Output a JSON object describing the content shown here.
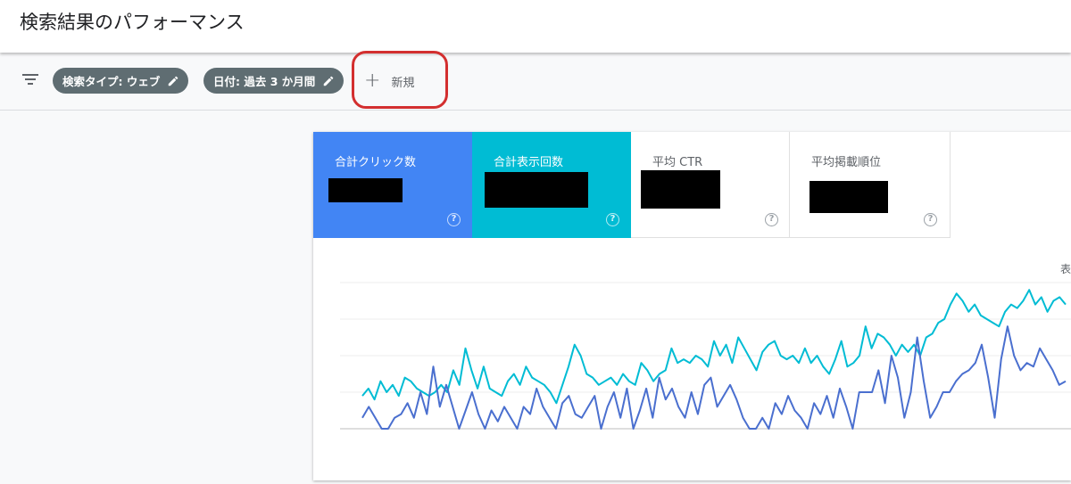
{
  "header": {
    "title": "検索結果のパフォーマンス"
  },
  "filters": {
    "chips": [
      {
        "label": "検索タイプ: ウェブ"
      },
      {
        "label": "日付: 過去 3 か月間"
      }
    ],
    "new_label": "新規"
  },
  "metrics": [
    {
      "label": "合計クリック数",
      "color": "#4285f4",
      "help": "?"
    },
    {
      "label": "合計表示回数",
      "color": "#00bcd4",
      "help": "?"
    },
    {
      "label": "平均 CTR",
      "help": "?"
    },
    {
      "label": "平均掲載順位",
      "help": "?"
    }
  ],
  "chart_legend_fragment": "表",
  "chart_data": {
    "type": "line",
    "title": "",
    "xlabel": "",
    "ylabel": "",
    "grid": true,
    "series": [
      {
        "color": "#00bcd4",
        "values": [
          0.9,
          1.1,
          0.8,
          1.3,
          1.0,
          1.2,
          0.9,
          1.4,
          1.3,
          1.1,
          1.0,
          0.9,
          1.0,
          1.2,
          1.0,
          1.6,
          1.2,
          2.2,
          1.6,
          1.1,
          1.7,
          1.1,
          1.0,
          0.9,
          1.3,
          1.5,
          1.2,
          1.7,
          1.4,
          1.3,
          1.2,
          1.0,
          0.7,
          1.2,
          1.7,
          2.3,
          2.0,
          1.5,
          1.4,
          1.2,
          1.3,
          1.4,
          1.2,
          1.5,
          1.3,
          1.2,
          1.8,
          1.6,
          1.3,
          1.5,
          1.6,
          2.2,
          1.8,
          1.9,
          1.8,
          2.0,
          1.9,
          1.7,
          2.4,
          2.0,
          2.3,
          1.8,
          2.5,
          2.2,
          1.9,
          1.6,
          2.1,
          2.3,
          2.4,
          2.0,
          1.9,
          2.0,
          1.8,
          2.2,
          1.8,
          2.0,
          1.7,
          1.5,
          1.9,
          2.4,
          1.7,
          1.8,
          2.0,
          2.8,
          2.2,
          2.6,
          2.5,
          2.3,
          2.0,
          2.3,
          2.1,
          2.3,
          2.0,
          2.5,
          2.6,
          2.9,
          3.0,
          3.4,
          3.7,
          3.5,
          3.2,
          3.4,
          3.1,
          3.0,
          2.9,
          2.8,
          3.2,
          3.4,
          3.3,
          3.5,
          3.8,
          3.4,
          3.6,
          3.2,
          3.5,
          3.6,
          3.4
        ]
      },
      {
        "color": "#4a6fcf",
        "values": [
          0.3,
          0.6,
          0.3,
          0.0,
          0.0,
          0.3,
          0.4,
          0.7,
          0.3,
          1.0,
          0.4,
          1.7,
          0.6,
          1.2,
          0.6,
          0.0,
          0.5,
          1.0,
          0.4,
          0.0,
          0.5,
          0.2,
          0.6,
          0.3,
          0.0,
          0.6,
          0.4,
          1.1,
          0.6,
          0.3,
          0.0,
          0.7,
          0.9,
          0.4,
          0.3,
          0.6,
          0.9,
          0.0,
          0.6,
          1.0,
          0.3,
          1.1,
          0.0,
          0.5,
          1.1,
          0.3,
          1.4,
          0.8,
          1.1,
          0.6,
          0.3,
          1.0,
          0.4,
          1.2,
          1.4,
          0.6,
          0.9,
          1.2,
          0.8,
          0.3,
          0.0,
          0.0,
          0.3,
          0.0,
          0.7,
          0.4,
          0.9,
          0.5,
          0.3,
          0.0,
          0.7,
          0.4,
          0.9,
          0.3,
          1.1,
          0.6,
          0.0,
          1.0,
          1.0,
          1.0,
          1.6,
          0.7,
          2.0,
          1.4,
          0.3,
          1.0,
          2.5,
          1.3,
          0.3,
          0.6,
          1.0,
          1.0,
          1.3,
          1.5,
          1.6,
          1.8,
          2.3,
          1.4,
          0.3,
          1.9,
          2.8,
          2.0,
          1.6,
          1.8,
          1.7,
          2.2,
          1.9,
          1.6,
          1.2,
          1.3
        ]
      }
    ],
    "ylim": [
      0,
      4
    ]
  }
}
